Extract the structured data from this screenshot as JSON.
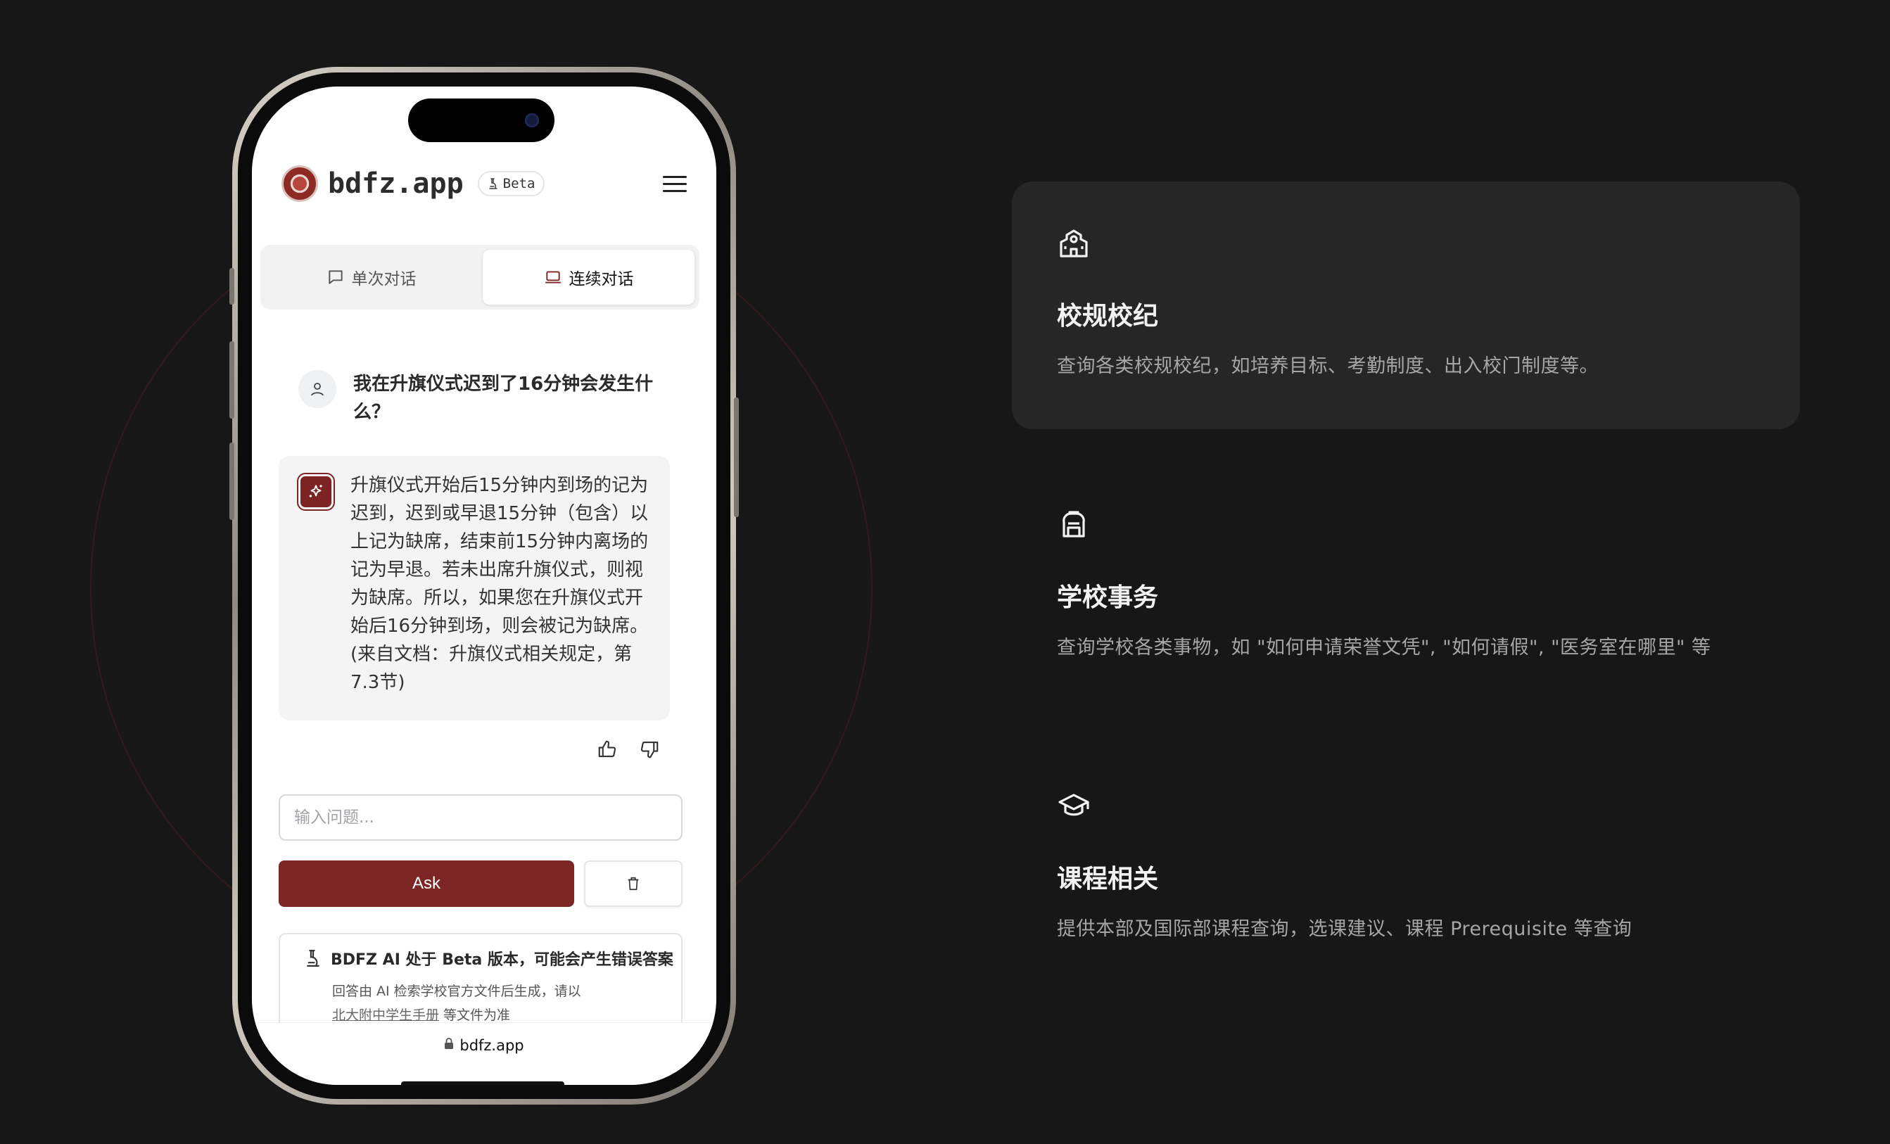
{
  "app": {
    "brand": "bdfz.app",
    "beta_label": "Beta",
    "url": "bdfz.app"
  },
  "tabs": [
    {
      "label": "单次对话",
      "icon": "message-icon",
      "active": false
    },
    {
      "label": "连续对话",
      "icon": "laptop-icon",
      "active": true
    }
  ],
  "chat": {
    "user_message": "我在升旗仪式迟到了16分钟会发生什么？",
    "ai_message": "升旗仪式开始后15分钟内到场的记为迟到，迟到或早退15分钟（包含）以上记为缺席，结束前15分钟内离场的记为早退。若未出席升旗仪式，则视为缺席。所以，如果您在升旗仪式开始后16分钟到场，则会被记为缺席。(来自文档：升旗仪式相关规定，第7.3节)"
  },
  "input": {
    "placeholder": "输入问题...",
    "value": ""
  },
  "buttons": {
    "ask": "Ask"
  },
  "notice": {
    "title": "BDFZ AI 处于 Beta 版本，可能会产生错误答案",
    "body_prefix": "回答由 AI 检索学校官方文件后生成，请以",
    "link": "北大附中学生手册",
    "body_suffix": " 等文件为准"
  },
  "features": [
    {
      "icon": "school-icon",
      "title": "校规校纪",
      "desc": "查询各类校规校纪，如培养目标、考勤制度、出入校门制度等。",
      "highlighted": true
    },
    {
      "icon": "backpack-icon",
      "title": "学校事务",
      "desc": "查询学校各类事物，如 \"如何申请荣誉文凭\", \"如何请假\", \"医务室在哪里\" 等",
      "highlighted": false
    },
    {
      "icon": "graduation-cap-icon",
      "title": "课程相关",
      "desc": "提供本部及国际部课程查询，选课建议、课程 Prerequisite 等查询",
      "highlighted": false
    }
  ],
  "colors": {
    "background": "#171717",
    "card": "#262626",
    "accent": "#7c2624"
  }
}
